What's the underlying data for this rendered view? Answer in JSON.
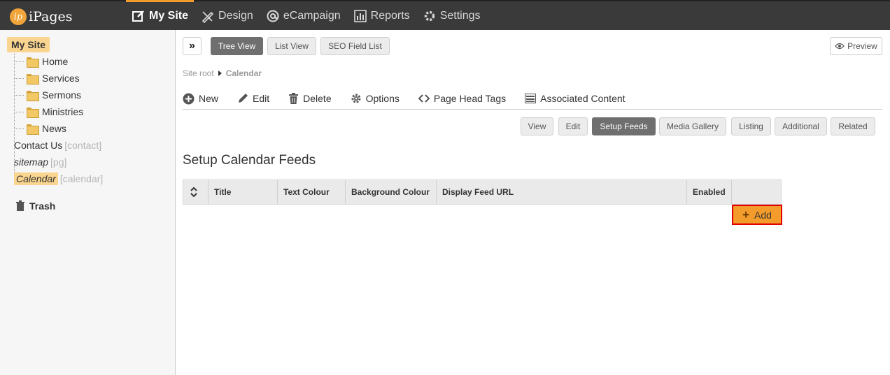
{
  "app": {
    "logo_mark": "ip",
    "logo_text": "iPages"
  },
  "nav": [
    {
      "label": "My Site",
      "icon": "edit-square-icon",
      "active": true
    },
    {
      "label": "Design",
      "icon": "pencil-ruler-icon",
      "active": false
    },
    {
      "label": "eCampaign",
      "icon": "at-sign-icon",
      "active": false
    },
    {
      "label": "Reports",
      "icon": "bar-chart-icon",
      "active": false
    },
    {
      "label": "Settings",
      "icon": "gear-icon",
      "active": false
    }
  ],
  "sidebar": {
    "root": "My Site",
    "items": [
      {
        "label": "Home",
        "folder": true
      },
      {
        "label": "Services",
        "folder": true
      },
      {
        "label": "Sermons",
        "folder": true
      },
      {
        "label": "Ministries",
        "folder": true
      },
      {
        "label": "News",
        "folder": true
      },
      {
        "label": "Contact Us",
        "suffix": "[contact]"
      },
      {
        "label": "sitemap",
        "suffix": "[pg]"
      },
      {
        "label": "Calendar",
        "suffix": "[calendar]"
      }
    ],
    "trash": "Trash"
  },
  "views": {
    "expand": "»",
    "tree_view": "Tree View",
    "list_view": "List View",
    "seo_list": "SEO Field List",
    "preview": "Preview"
  },
  "breadcrumb": {
    "root": "Site root",
    "current": "Calendar"
  },
  "toolbar": {
    "new": "New",
    "edit": "Edit",
    "delete": "Delete",
    "options": "Options",
    "head_tags": "Page Head Tags",
    "associated": "Associated Content"
  },
  "subtabs": [
    "View",
    "Edit",
    "Setup Feeds",
    "Media Gallery",
    "Listing",
    "Additional",
    "Related"
  ],
  "section_title": "Setup Calendar Feeds",
  "table": {
    "columns": [
      "Title",
      "Text Colour",
      "Background Colour",
      "Display Feed URL",
      "Enabled"
    ]
  },
  "add_label": "Add",
  "colors": {
    "accent": "#f39c2b",
    "topbar": "#3a3a3a",
    "highlight": "#f9d58f"
  }
}
